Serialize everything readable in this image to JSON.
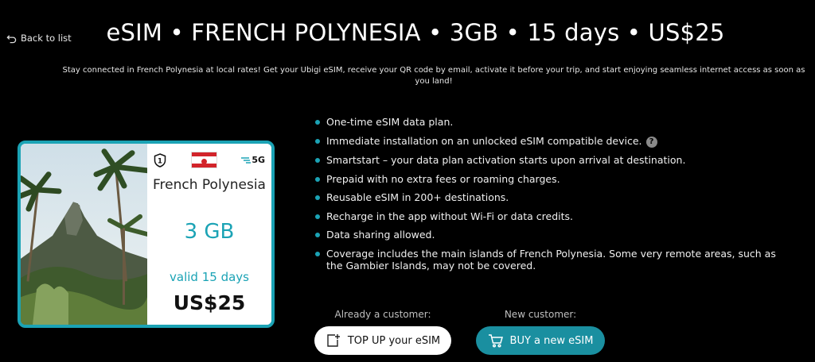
{
  "nav": {
    "back_label": "Back to list",
    "back_icon": "back-arrow-icon"
  },
  "header": {
    "title": "eSIM • FRENCH POLYNESIA • 3GB • 15 days • US$25"
  },
  "description": "Stay connected in French Polynesia at local rates! Get your Ubigi eSIM, receive your QR code by email, activate it before your trip, and start enjoying seamless internet access as soon as you land!",
  "card": {
    "shield_label": "1",
    "network_label": "5G",
    "country": "French Polynesia",
    "data": "3 GB",
    "validity": "valid 15 days",
    "price": "US$25",
    "accent_color": "#1ba3b5"
  },
  "features": [
    "One-time eSIM data plan.",
    "Immediate installation on an unlocked eSIM compatible device.",
    "Smartstart – your data plan activation starts upon arrival at destination.",
    "Prepaid with no extra fees or roaming charges.",
    "Reusable eSIM in 200+ destinations.",
    "Recharge in the app without Wi-Fi or data credits.",
    "Data sharing allowed.",
    "Coverage includes the main islands of French Polynesia. Some very remote areas, such as the Gambier Islands, may not be covered."
  ],
  "help_icon_label": "?",
  "cta": {
    "existing_label": "Already a customer:",
    "topup_button": "TOP UP your eSIM",
    "new_label": "New customer:",
    "buy_button": "BUY a new eSIM"
  }
}
